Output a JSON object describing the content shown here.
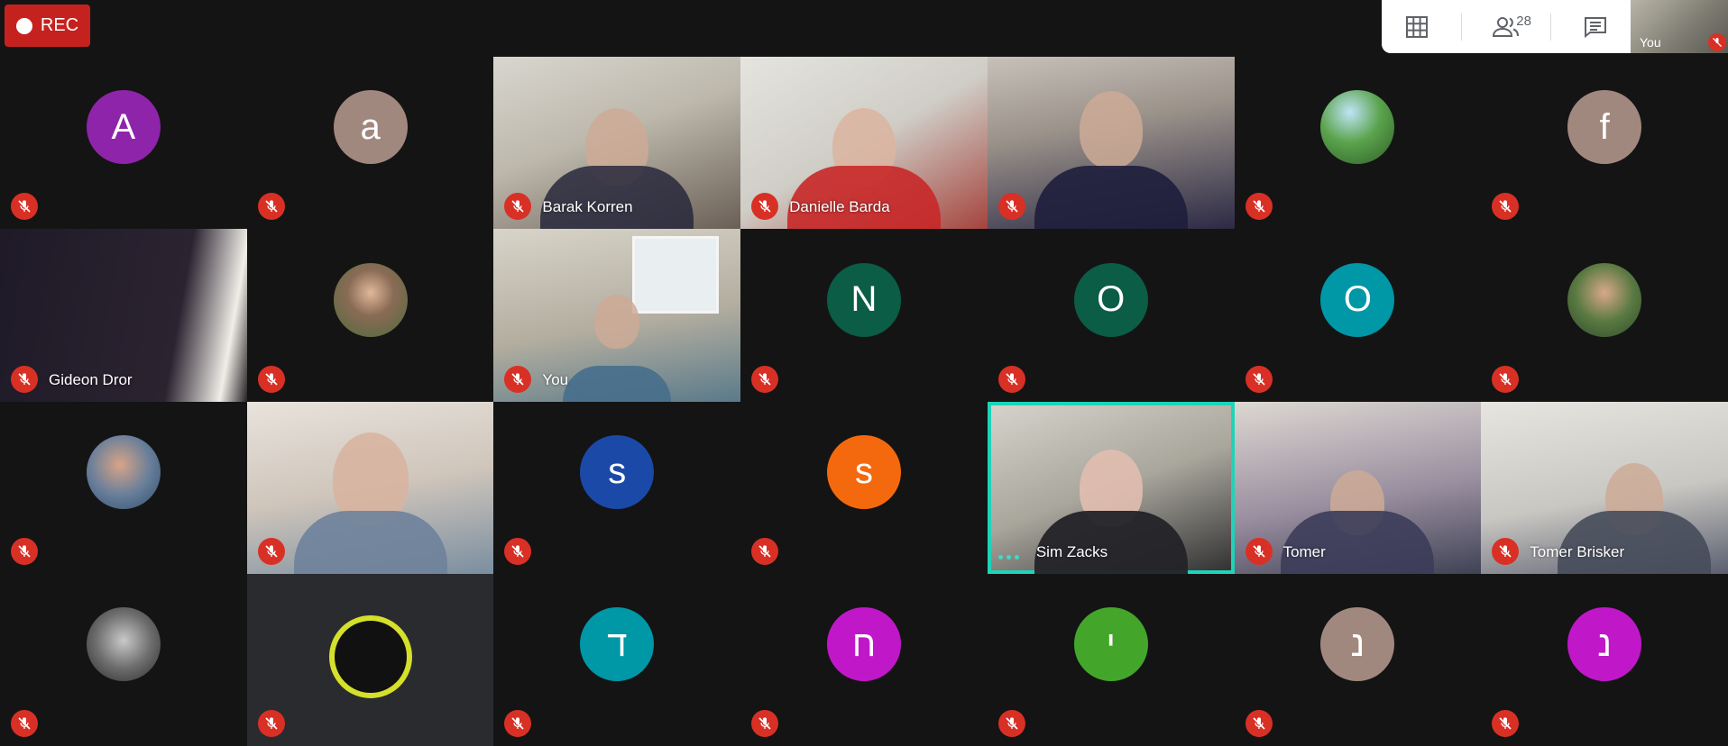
{
  "recording": {
    "label": "REC"
  },
  "toolbar": {
    "participant_count": "28"
  },
  "self_view": {
    "name": "You"
  },
  "tiles": [
    {
      "name": "",
      "initial": "A",
      "color": "#8e24aa"
    },
    {
      "name": "",
      "initial": "a",
      "color": "#a1887f"
    },
    {
      "name": "Barak Korren"
    },
    {
      "name": "Danielle Barda"
    },
    {
      "name": ""
    },
    {
      "name": "",
      "initial": ""
    },
    {
      "name": "",
      "initial": "f",
      "color": "#a1887f"
    },
    {
      "name": "Gideon Dror"
    },
    {
      "name": "",
      "initial": ""
    },
    {
      "name": "You"
    },
    {
      "name": "",
      "initial": "N",
      "color": "#0b5d45"
    },
    {
      "name": "",
      "initial": "O",
      "color": "#0b5d45"
    },
    {
      "name": "",
      "initial": "O",
      "color": "#0097a7"
    },
    {
      "name": "",
      "initial": ""
    },
    {
      "name": "",
      "initial": ""
    },
    {
      "name": ""
    },
    {
      "name": "",
      "initial": "s",
      "color": "#1a49a8"
    },
    {
      "name": "",
      "initial": "s",
      "color": "#f4690d"
    },
    {
      "name": "Sim Zacks"
    },
    {
      "name": "Tomer"
    },
    {
      "name": "Tomer Brisker"
    },
    {
      "name": "",
      "initial": ""
    },
    {
      "name": ""
    },
    {
      "name": "",
      "initial": "ד",
      "color": "#0097a7"
    },
    {
      "name": "",
      "initial": "ח",
      "color": "#c018c9"
    },
    {
      "name": "",
      "initial": "י",
      "color": "#43a62b"
    },
    {
      "name": "",
      "initial": "נ",
      "color": "#a1887f"
    },
    {
      "name": "",
      "initial": "נ",
      "color": "#c018c9"
    }
  ]
}
